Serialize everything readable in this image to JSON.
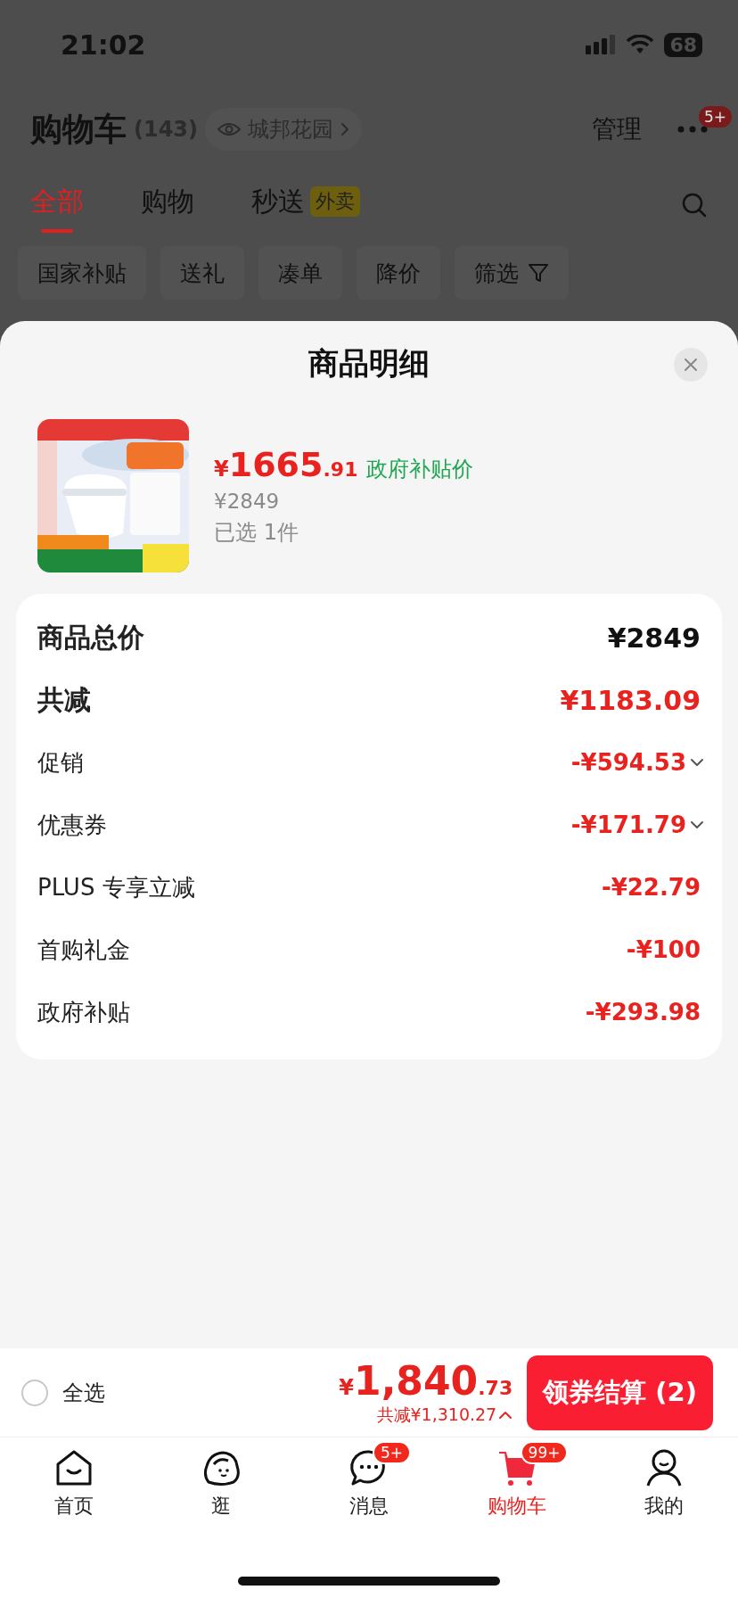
{
  "status_bar": {
    "time": "21:02",
    "battery": "68"
  },
  "header": {
    "title": "购物车",
    "count": "(143)",
    "location": "城邦花园",
    "manage": "管理",
    "more_badge": "5+"
  },
  "tabs": [
    {
      "label": "全部",
      "selected": true
    },
    {
      "label": "购物",
      "selected": false
    },
    {
      "label": "秒送",
      "badge": "外卖",
      "selected": false
    }
  ],
  "filters": [
    {
      "label": "国家补贴",
      "kind": "chip"
    },
    {
      "label": "送礼",
      "kind": "chip"
    },
    {
      "label": "凑单",
      "kind": "chip"
    },
    {
      "label": "降价",
      "kind": "chip"
    },
    {
      "label": "筛选",
      "kind": "filter"
    }
  ],
  "sheet": {
    "title": "商品明细",
    "product": {
      "kind": "picture",
      "currency": "¥",
      "price_int": "1665",
      "price_dec": ".91",
      "price_tag": "政府补贴价",
      "original_price": "¥2849",
      "selected_count": "已选 1件"
    },
    "summary": [
      {
        "label": "商品总价",
        "value": "¥2849",
        "kind": "total"
      },
      {
        "label": "共减",
        "value": "¥1183.09",
        "kind": "discount_total"
      },
      {
        "label": "促销",
        "value": "-¥594.53",
        "kind": "expandable"
      },
      {
        "label": "优惠券",
        "value": "-¥171.79",
        "kind": "expandable"
      },
      {
        "label": "PLUS 专享立减",
        "value": "-¥22.79",
        "kind": "plain"
      },
      {
        "label": "首购礼金",
        "value": "-¥100",
        "kind": "plain"
      },
      {
        "label": "政府补贴",
        "value": "-¥293.98",
        "kind": "plain"
      }
    ]
  },
  "checkout": {
    "select_all": {
      "label": "全选",
      "checked": false
    },
    "currency": "¥",
    "total_int": "1,840",
    "total_dec": ".73",
    "savings": "共减¥1,310.27",
    "button": "领券结算 (2)"
  },
  "nav": [
    {
      "label": "首页",
      "kind": "home",
      "selected": false
    },
    {
      "label": "逛",
      "kind": "blob",
      "selected": false
    },
    {
      "label": "消息",
      "kind": "chat",
      "badge": "5+",
      "selected": false
    },
    {
      "label": "购物车",
      "kind": "cart",
      "badge": "99+",
      "selected": true
    },
    {
      "label": "我的",
      "kind": "person",
      "selected": false
    }
  ]
}
